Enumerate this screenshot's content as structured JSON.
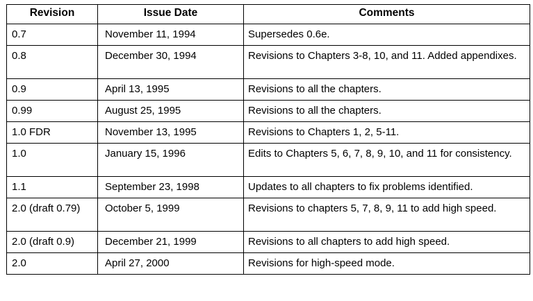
{
  "headers": [
    "Revision",
    "Issue Date",
    "Comments"
  ],
  "rows": [
    {
      "revision": "0.7",
      "date": "November 11, 1994",
      "comments": "Supersedes 0.6e."
    },
    {
      "revision": "0.8",
      "date": "December 30, 1994",
      "comments": "Revisions to Chapters 3-8, 10, and 11.  Added appendixes."
    },
    {
      "revision": "0.9",
      "date": "April 13, 1995",
      "comments": "Revisions to all the chapters."
    },
    {
      "revision": "0.99",
      "date": "August 25, 1995",
      "comments": "Revisions to all the chapters."
    },
    {
      "revision": "1.0 FDR",
      "date": "November 13, 1995",
      "comments": "Revisions to Chapters 1, 2, 5-11."
    },
    {
      "revision": "1.0",
      "date": "January 15, 1996",
      "comments": "Edits to Chapters 5, 6, 7, 8, 9, 10, and 11 for consistency."
    },
    {
      "revision": "1.1",
      "date": "September 23, 1998",
      "comments": "Updates to all chapters to fix problems identified."
    },
    {
      "revision": "2.0 (draft 0.79)",
      "date": "October 5, 1999",
      "comments": "Revisions to chapters 5, 7, 8, 9, 11 to add high speed."
    },
    {
      "revision": "2.0 (draft 0.9)",
      "date": "December 21, 1999",
      "comments": "Revisions to all chapters to add high speed."
    },
    {
      "revision": "2.0",
      "date": "April 27, 2000",
      "comments": "Revisions for high-speed mode."
    }
  ]
}
